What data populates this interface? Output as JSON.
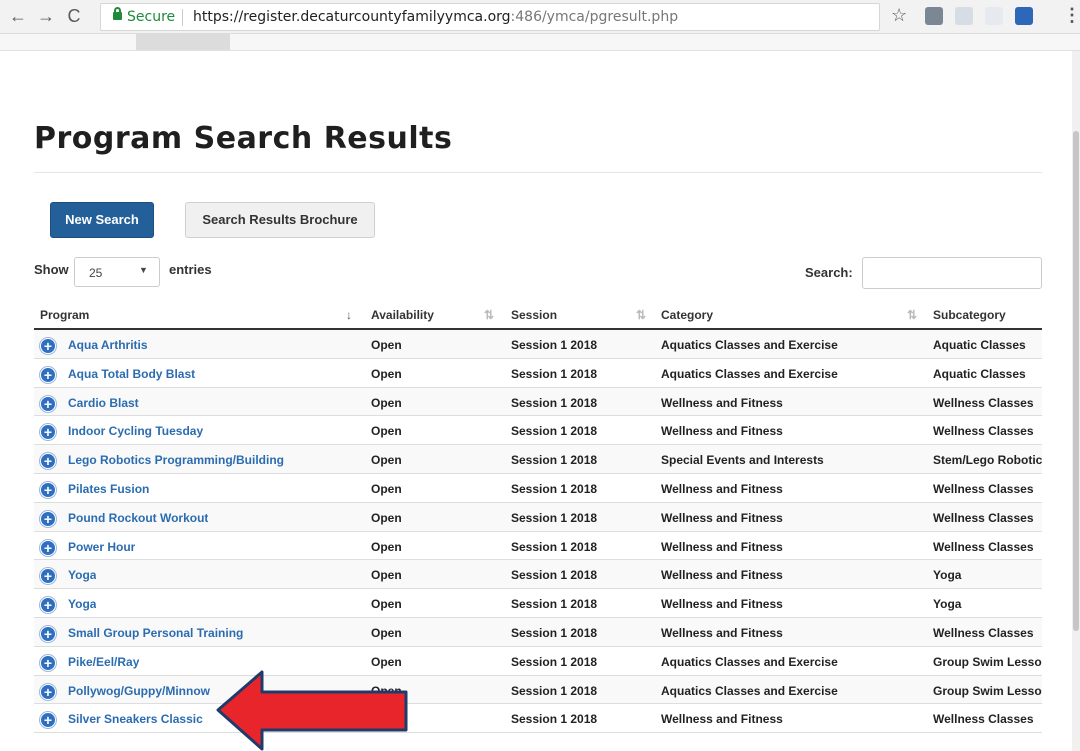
{
  "browser": {
    "secure_label": "Secure",
    "url_host": "https://register.decaturcountyfamilyymca.org",
    "url_path": ":486/ymca/pgresult.php"
  },
  "page": {
    "title": "Program Search Results",
    "new_search_label": "New Search",
    "brochure_label": "Search Results Brochure",
    "show_label": "Show",
    "entries_value": "25",
    "entries_label": "entries",
    "search_label": "Search:",
    "search_value": ""
  },
  "table": {
    "columns": [
      "Program",
      "Availability",
      "Session",
      "Category",
      "Subcategory"
    ],
    "rows": [
      [
        "Aqua Arthritis",
        "Open",
        "Session 1 2018",
        "Aquatics Classes and Exercise",
        "Aquatic Classes"
      ],
      [
        "Aqua Total Body Blast",
        "Open",
        "Session 1 2018",
        "Aquatics Classes and Exercise",
        "Aquatic Classes"
      ],
      [
        "Cardio Blast",
        "Open",
        "Session 1 2018",
        "Wellness and Fitness",
        "Wellness Classes"
      ],
      [
        "Indoor Cycling Tuesday",
        "Open",
        "Session 1 2018",
        "Wellness and Fitness",
        "Wellness Classes"
      ],
      [
        "Lego Robotics Programming/Building",
        "Open",
        "Session 1 2018",
        "Special Events and Interests",
        "Stem/Lego Robotics"
      ],
      [
        "Pilates Fusion",
        "Open",
        "Session 1 2018",
        "Wellness and Fitness",
        "Wellness Classes"
      ],
      [
        "Pound Rockout Workout",
        "Open",
        "Session 1 2018",
        "Wellness and Fitness",
        "Wellness Classes"
      ],
      [
        "Power Hour",
        "Open",
        "Session 1 2018",
        "Wellness and Fitness",
        "Wellness Classes"
      ],
      [
        "Yoga",
        "Open",
        "Session 1 2018",
        "Wellness and Fitness",
        "Yoga"
      ],
      [
        "Yoga",
        "Open",
        "Session 1 2018",
        "Wellness and Fitness",
        "Yoga"
      ],
      [
        "Small Group Personal Training",
        "Open",
        "Session 1 2018",
        "Wellness and Fitness",
        "Wellness Classes"
      ],
      [
        "Pike/Eel/Ray",
        "Open",
        "Session 1 2018",
        "Aquatics Classes and Exercise",
        "Group Swim Lessons"
      ],
      [
        "Pollywog/Guppy/Minnow",
        "Open",
        "Session 1 2018",
        "Aquatics Classes and Exercise",
        "Group Swim Lessons"
      ],
      [
        "Silver Sneakers Classic",
        "",
        "Session 1 2018",
        "Wellness and Fitness",
        "Wellness Classes"
      ]
    ]
  },
  "colors": {
    "primary_button": "#236099",
    "link": "#2b6cb0",
    "annotation_arrow": "#e8252a"
  }
}
